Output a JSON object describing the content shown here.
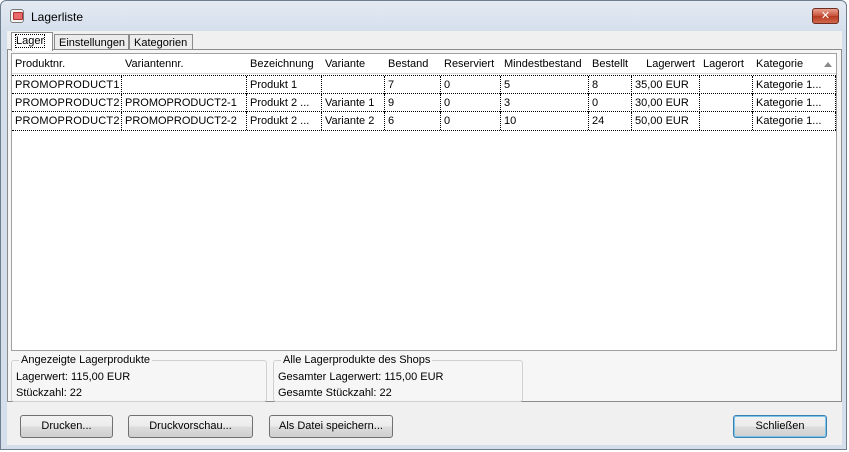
{
  "window": {
    "title": "Lagerliste",
    "close_glyph": "✕",
    "icon": "cart-icon"
  },
  "tabs": [
    {
      "label": "Lager",
      "active": true
    },
    {
      "label": "Einstellungen",
      "active": false
    },
    {
      "label": "Kategorien",
      "active": false
    }
  ],
  "table": {
    "columns": [
      "Produktnr.",
      "Variantennr.",
      "Bezeichnung",
      "Variante",
      "Bestand",
      "Reserviert",
      "Mindestbestand",
      "Bestellt",
      "Lagerwert",
      "Lagerort",
      "Kategorie"
    ],
    "sorted_column": "Kategorie",
    "rows": [
      [
        "PROMOPRODUCT1",
        "",
        "Produkt 1",
        "",
        "7",
        "0",
        "5",
        "8",
        "35,00 EUR",
        "",
        "Kategorie 1..."
      ],
      [
        "PROMOPRODUCT2",
        "PROMOPRODUCT2-1",
        "Produkt 2 ...",
        "Variante 1",
        "9",
        "0",
        "3",
        "0",
        "30,00 EUR",
        "",
        "Kategorie 1..."
      ],
      [
        "PROMOPRODUCT2",
        "PROMOPRODUCT2-2",
        "Produkt 2 ...",
        "Variante 2",
        "6",
        "0",
        "10",
        "24",
        "50,00 EUR",
        "",
        "Kategorie 1..."
      ]
    ]
  },
  "summary_displayed": {
    "title": "Angezeigte Lagerprodukte",
    "lagerwert": "Lagerwert: 115,00 EUR",
    "stueckzahl": "Stückzahl: 22"
  },
  "summary_shop": {
    "title": "Alle Lagerprodukte des Shops",
    "lagerwert": "Gesamter Lagerwert: 115,00 EUR",
    "stueckzahl": "Gesamte Stückzahl: 22"
  },
  "buttons": {
    "print": "Drucken...",
    "preview": "Druckvorschau...",
    "save_file": "Als Datei speichern...",
    "close": "Schließen"
  }
}
